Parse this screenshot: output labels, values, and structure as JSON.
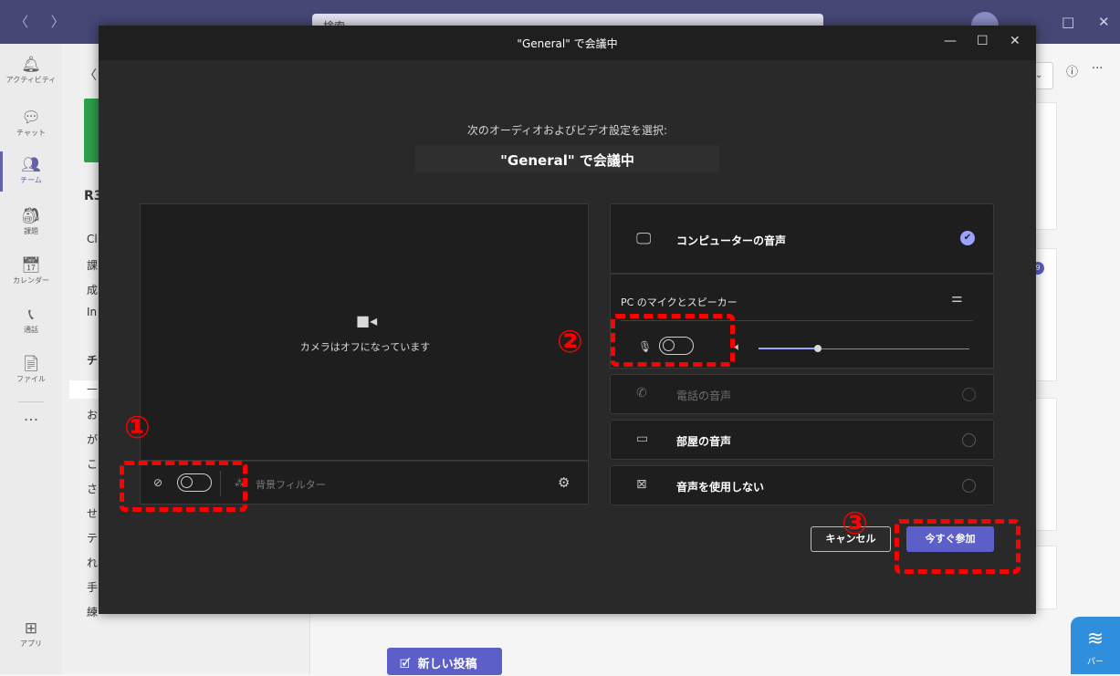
{
  "app": {
    "nav_arrows": "〈 〉",
    "search_placeholder": "検索",
    "window_controls": [
      "□",
      "✕"
    ],
    "rail": [
      {
        "icon": "bell-icon",
        "glyph": "🔔︎",
        "label": "アクティビティ"
      },
      {
        "icon": "chat-icon",
        "glyph": "💬︎",
        "label": "チャット"
      },
      {
        "icon": "teams-icon",
        "glyph": "👥︎",
        "label": "チーム"
      },
      {
        "icon": "assignments-icon",
        "glyph": "🎒︎",
        "label": "課題"
      },
      {
        "icon": "calendar-icon",
        "glyph": "📅︎",
        "label": "カレンダー"
      },
      {
        "icon": "phone-icon",
        "glyph": "📞︎",
        "label": "通話"
      },
      {
        "icon": "file-icon",
        "glyph": "📄︎",
        "label": "ファイル"
      },
      {
        "icon": "more-icon",
        "glyph": "···",
        "label": ""
      }
    ],
    "apps_label": "アプリ",
    "apps_glyph": "⊞",
    "back_glyph": "〈",
    "team_name_peek": "R3",
    "channel_peek": [
      "Cl",
      "課",
      "成",
      "In"
    ],
    "section_peek": "チャ",
    "channel_list_peek": [
      "—",
      "お",
      "が",
      "こ",
      "さ",
      "せ",
      "テ",
      "れ",
      "手",
      "練"
    ],
    "header_info_glyph": "ⓘ",
    "header_more_glyph": "···",
    "dropdown_glyph": "⌄",
    "badge_text": "9",
    "new_post_glyph": "🗹",
    "new_post_label": "新しい投稿",
    "corner_widget_glyph": "≋",
    "corner_widget_label": "パー"
  },
  "dialog": {
    "title": "\"General\" で会議中",
    "controls": [
      "—",
      "☐",
      "✕"
    ],
    "prompt": "次のオーディオおよびビデオ設定を選択:",
    "meeting_title": "\"General\" で会議中",
    "video": {
      "camera_off_glyph": "■◂",
      "camera_off_text": "カメラはオフになっています",
      "camera_toggle_glyph": "⊘",
      "background_glyph": "⁂",
      "background_filter_label": "背景フィルター",
      "settings_glyph": "⚙"
    },
    "audio_options": [
      {
        "key": "computer",
        "icon": "monitor-speaker-icon",
        "glyph": "🖵",
        "label": "コンピューターの音声",
        "selected": true,
        "check_glyph": "✔"
      },
      {
        "key": "phone",
        "icon": "phone-audio-icon",
        "glyph": "✆",
        "label": "電話の音声",
        "selected": false,
        "disabled": true
      },
      {
        "key": "room",
        "icon": "room-audio-icon",
        "glyph": "▭",
        "label": "部屋の音声",
        "selected": false
      },
      {
        "key": "none",
        "icon": "no-audio-icon",
        "glyph": "⊠",
        "label": "音声を使用しない",
        "selected": false
      }
    ],
    "pc_device_label": "PC のマイクとスピーカー",
    "device_settings_glyph": "⚌",
    "mic_glyph": "🎙︎",
    "speaker_glyph": "🔈︎",
    "mic_enabled": false,
    "camera_enabled": false,
    "volume": 0.28,
    "cancel_label": "キャンセル",
    "join_label": "今すぐ参加"
  },
  "annotations": [
    "①",
    "②",
    "③"
  ],
  "colors": {
    "titlebar": "#464775",
    "accent": "#5b5fc7",
    "selected_check": "#9ea2ff",
    "annotation": "#ff0000"
  }
}
